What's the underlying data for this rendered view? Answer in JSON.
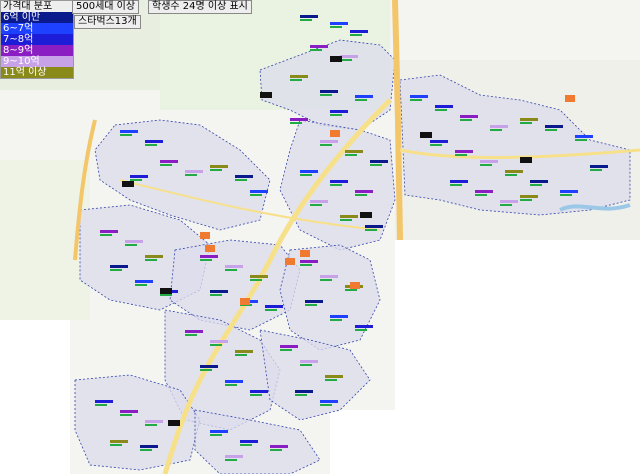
{
  "legend": {
    "title": "가격대 분포",
    "items": [
      {
        "label": "6억 이만",
        "color": "#0a1a8c"
      },
      {
        "label": "6~7억",
        "color": "#1e40ff"
      },
      {
        "label": "7~8억",
        "color": "#1d1dd8"
      },
      {
        "label": "8~9억",
        "color": "#8a1ec2"
      },
      {
        "label": "9~10억",
        "color": "#c8a2e8"
      },
      {
        "label": "11억 이상",
        "color": "#8a8a1a"
      }
    ]
  },
  "controls": {
    "filter_households": "500세대 이상",
    "filter_students": "학생수 24명 이상 표시",
    "starbucks": "스타벅스13개"
  },
  "map": {
    "district_fill": "#dcdcec",
    "district_border": "#3344aa",
    "road_highway": "#f3c66a",
    "road_main": "#f7e08a",
    "starbucks_marker": "#f07a30",
    "station_marker": "#111111",
    "park_color": "#cfe6c2"
  }
}
